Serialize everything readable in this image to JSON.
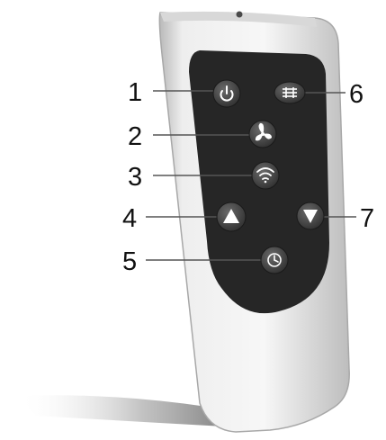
{
  "callouts": [
    {
      "number": "1",
      "button": "power"
    },
    {
      "number": "2",
      "button": "fan-speed"
    },
    {
      "number": "3",
      "button": "oscillation"
    },
    {
      "number": "4",
      "button": "up"
    },
    {
      "number": "5",
      "button": "timer"
    },
    {
      "number": "6",
      "button": "mode"
    },
    {
      "number": "7",
      "button": "down"
    }
  ],
  "colors": {
    "remote_body": "#eeeeee",
    "panel": "#262626",
    "button": "#4b4b4b",
    "leader_line": "#555555"
  }
}
